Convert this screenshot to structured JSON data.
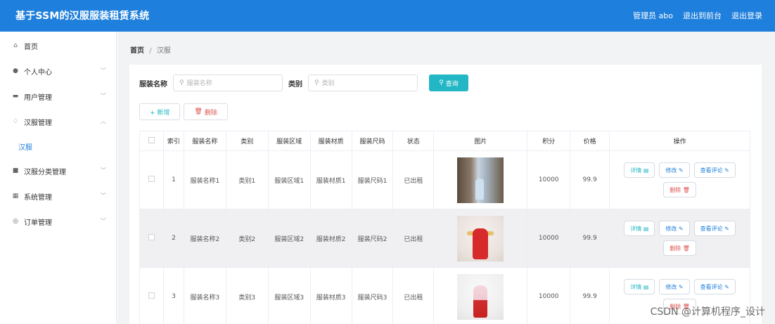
{
  "header": {
    "title": "基于SSM的汉服服装租赁系统",
    "admin": "管理员 abo",
    "back_to_front": "退出到前台",
    "logout": "退出登录"
  },
  "sidebar": {
    "items": [
      {
        "label": "首页",
        "icon": "home-icon",
        "glyph": "⌂"
      },
      {
        "label": "个人中心",
        "icon": "user-icon",
        "glyph": "●"
      },
      {
        "label": "用户管理",
        "icon": "users-icon",
        "glyph": "▬"
      },
      {
        "label": "汉服管理",
        "icon": "clothing-icon",
        "glyph": "♢"
      },
      {
        "label": "汉服",
        "sub": true
      },
      {
        "label": "汉服分类管理",
        "icon": "category-icon",
        "glyph": "■"
      },
      {
        "label": "系统管理",
        "icon": "grid-icon",
        "glyph": "▦"
      },
      {
        "label": "订单管理",
        "icon": "order-icon",
        "glyph": "◎"
      }
    ]
  },
  "breadcrumb": {
    "home": "首页",
    "sep": "/",
    "current": "汉服"
  },
  "search": {
    "name_label": "服装名称",
    "name_placeholder": "服装名称",
    "type_label": "类别",
    "type_placeholder": "类别",
    "query_label": "查询"
  },
  "actions": {
    "add_label": "+ 新增",
    "delete_label": "删除"
  },
  "table": {
    "headers": [
      "索引",
      "服装名称",
      "类别",
      "服装区域",
      "服装材质",
      "服装尺码",
      "状态",
      "图片",
      "积分",
      "价格",
      "操作"
    ],
    "rows": [
      {
        "index": "1",
        "name": "服装名称1",
        "type": "类别1",
        "region": "服装区域1",
        "material": "服装材质1",
        "size": "服装尺码1",
        "status": "已出租",
        "points": "10000",
        "price": "99.9"
      },
      {
        "index": "2",
        "name": "服装名称2",
        "type": "类别2",
        "region": "服装区域2",
        "material": "服装材质2",
        "size": "服装尺码2",
        "status": "已出租",
        "points": "10000",
        "price": "99.9"
      },
      {
        "index": "3",
        "name": "服装名称3",
        "type": "类别3",
        "region": "服装区域3",
        "material": "服装材质3",
        "size": "服装尺码3",
        "status": "已出租",
        "points": "10000",
        "price": "99.9"
      }
    ],
    "ops": {
      "detail": "详情",
      "edit": "修改",
      "review": "查看评论",
      "remove": "删除"
    }
  },
  "watermark": "CSDN @计算机程序_设计",
  "colors": {
    "topbar": "#1e7fdc",
    "accent": "#23b7c6",
    "danger": "#e05252"
  }
}
